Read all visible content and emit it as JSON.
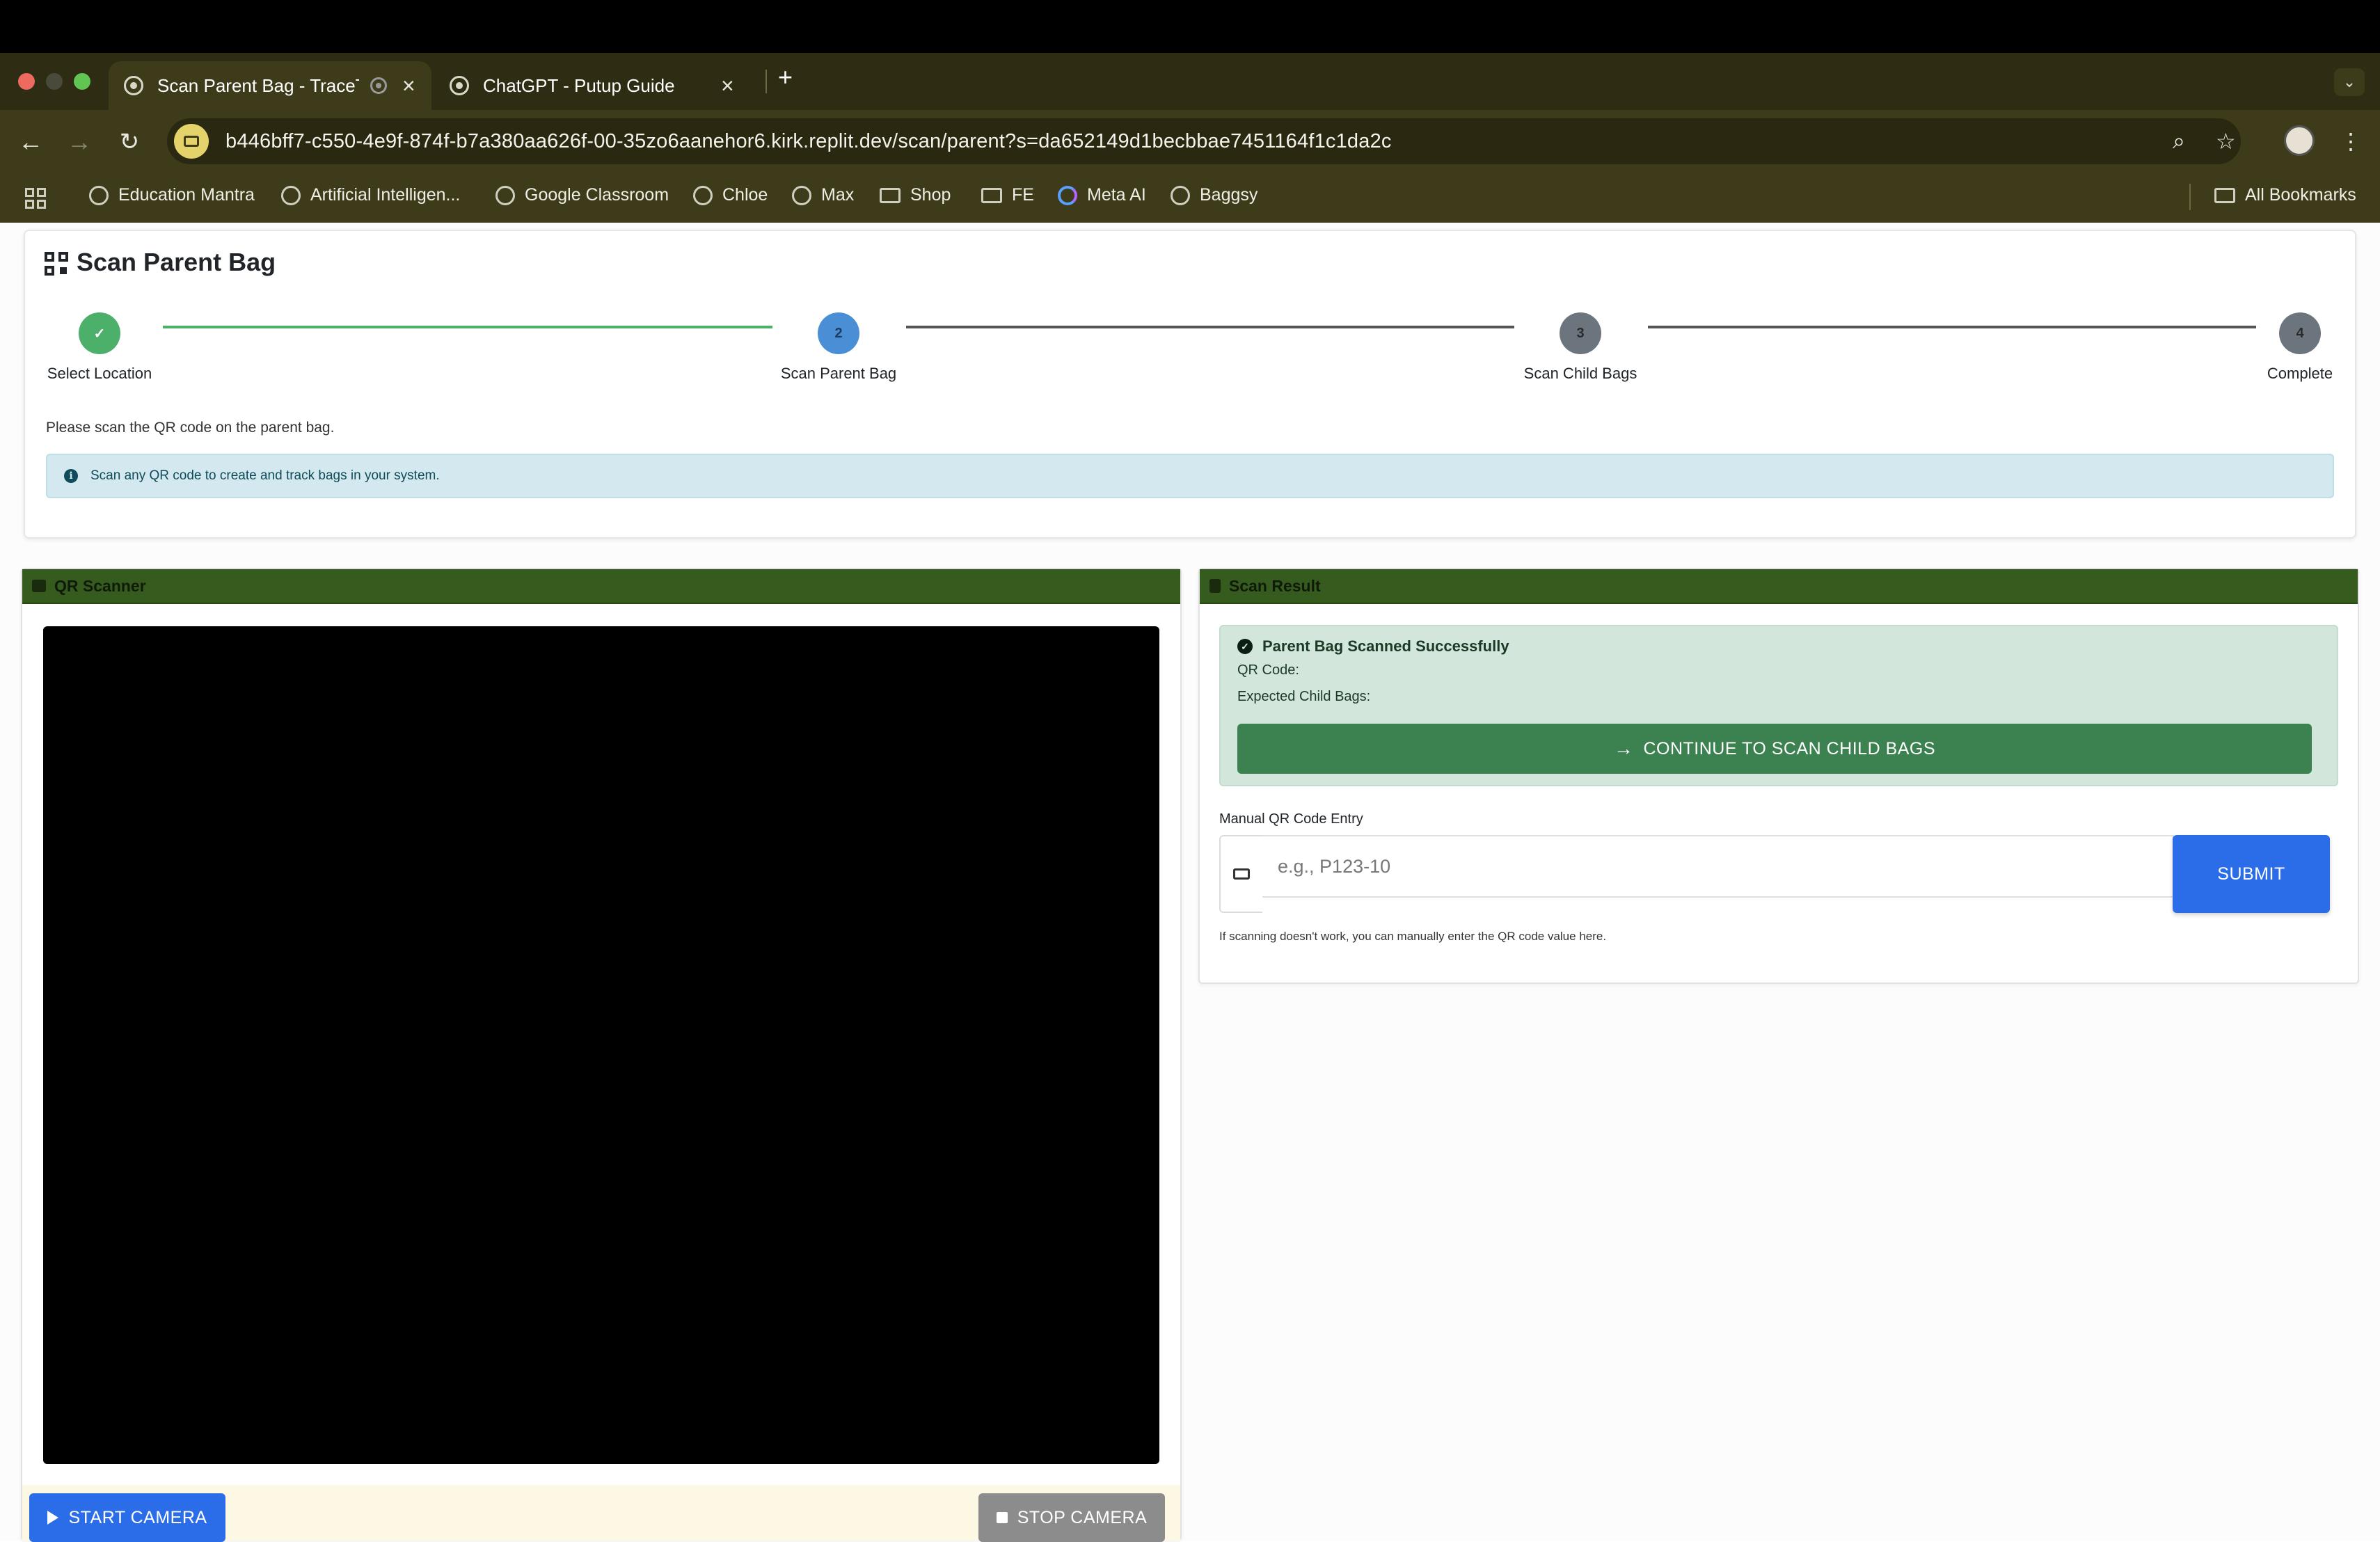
{
  "browser": {
    "tabs": [
      {
        "title": "Scan Parent Bag - TraceTr",
        "active": true
      },
      {
        "title": "ChatGPT - Putup Guide",
        "active": false
      }
    ],
    "new_tab": "+",
    "url": "b446bff7-c550-4e9f-874f-b7a380aa626f-00-35zo6aanehor6.kirk.replit.dev/scan/parent?s=da652149d1becbbae7451164f1c1da2c",
    "bookmarks": [
      {
        "label": "Education Mantra",
        "icon": "globe-icon"
      },
      {
        "label": "Artificial Intelligen...",
        "icon": "globe-icon"
      },
      {
        "label": "Google Classroom",
        "icon": "globe-icon"
      },
      {
        "label": "Chloe",
        "icon": "globe-icon"
      },
      {
        "label": "Max",
        "icon": "globe-icon"
      },
      {
        "label": "Shop",
        "icon": "folder-icon"
      },
      {
        "label": "FE",
        "icon": "folder-icon"
      },
      {
        "label": "Meta AI",
        "icon": "meta-icon"
      },
      {
        "label": "Baggsy",
        "icon": "openai-icon"
      }
    ],
    "all_bookmarks": "All Bookmarks"
  },
  "page": {
    "title": "Scan Parent Bag",
    "steps": [
      {
        "number": "✓",
        "label": "Select Location",
        "state": "done",
        "color": "#4caf6a"
      },
      {
        "number": "2",
        "label": "Scan Parent Bag",
        "state": "active",
        "color": "#4a8fd6"
      },
      {
        "number": "3",
        "label": "Scan Child Bags",
        "state": "pending",
        "color": "#6c757d"
      },
      {
        "number": "4",
        "label": "Complete",
        "state": "pending",
        "color": "#6c757d"
      }
    ],
    "instruction": "Please scan the QR code on the parent bag.",
    "info_alert": "Scan any QR code to create and track bags in your system."
  },
  "scanner": {
    "header": "QR Scanner",
    "start_label": "START CAMERA",
    "stop_label": "STOP CAMERA"
  },
  "result": {
    "header": "Scan Result",
    "success_title": "Parent Bag Scanned Successfully",
    "qr_code_label": "QR Code:",
    "expected_label": "Expected Child Bags:",
    "continue_label": "CONTINUE TO SCAN CHILD BAGS",
    "manual_label": "Manual QR Code Entry",
    "input_placeholder": "e.g., P123-10",
    "submit_label": "SUBMIT",
    "help_text": "If scanning doesn't work, you can manually enter the QR code value here."
  },
  "colors": {
    "card_header": "#365b1e",
    "primary": "#2b6ce8",
    "success": "#3c8250",
    "info_bg": "#d4e9ef"
  }
}
